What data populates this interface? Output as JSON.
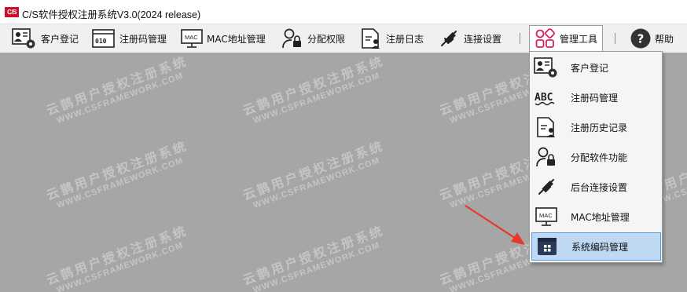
{
  "window": {
    "logo_text": "C/S",
    "title": "C/S软件授权注册系统V3.0(2024 release)"
  },
  "toolbar": {
    "items": [
      {
        "label": "客户登记",
        "icon": "customer-settings-icon"
      },
      {
        "label": "注册码管理",
        "icon": "binary-code-icon"
      },
      {
        "label": "MAC地址管理",
        "icon": "mac-monitor-icon"
      },
      {
        "label": "分配权限",
        "icon": "user-lock-icon"
      },
      {
        "label": "注册日志",
        "icon": "user-log-icon"
      },
      {
        "label": "连接设置",
        "icon": "plug-connect-icon"
      },
      {
        "label": "管理工具",
        "icon": "apps-grid-icon"
      },
      {
        "label": "帮助",
        "icon": "help-icon"
      }
    ]
  },
  "menu": {
    "items": [
      {
        "label": "客户登记",
        "icon": "customer-settings-icon"
      },
      {
        "label": "注册码管理",
        "icon": "abc-code-icon"
      },
      {
        "label": "注册历史记录",
        "icon": "user-log-icon"
      },
      {
        "label": "分配软件功能",
        "icon": "user-lock-icon"
      },
      {
        "label": "后台连接设置",
        "icon": "plug-connect-icon"
      },
      {
        "label": "MAC地址管理",
        "icon": "mac-monitor-icon"
      },
      {
        "label": "系统编码管理",
        "icon": "calendar-grid-icon"
      }
    ],
    "selected_index": 6
  },
  "watermark": {
    "line1": "云鹊用户授权注册系统",
    "line2": "WWW.CSFRAMEWORK.COM"
  },
  "colors": {
    "workspace": "#a6a6a6",
    "toolbar": "#f0f0f0",
    "menu_selected": "#bfd9f4",
    "annotation_arrow": "#e8382a",
    "logo_red": "#c8102e"
  }
}
